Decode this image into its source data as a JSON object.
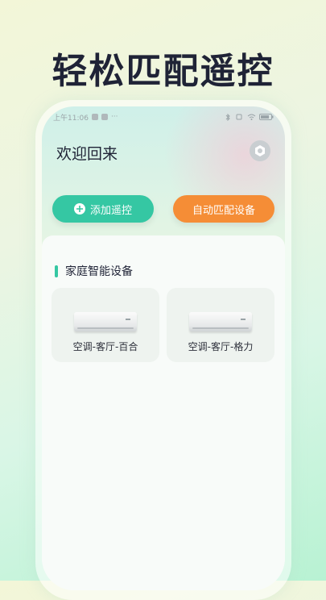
{
  "promo": {
    "headline": "轻松匹配遥控"
  },
  "status_bar": {
    "time": "上午11:06",
    "extra": "···"
  },
  "header": {
    "title": "欢迎回来",
    "settings_icon": "gear-icon"
  },
  "actions": {
    "add_remote": "添加遥控",
    "auto_match": "自动匹配设备"
  },
  "section": {
    "title": "家庭智能设备"
  },
  "devices": [
    {
      "name": "空调-客厅-百合",
      "icon": "air-conditioner-icon"
    },
    {
      "name": "空调-客厅-格力",
      "icon": "air-conditioner-icon"
    }
  ],
  "colors": {
    "accent_green": "#35c7a3",
    "accent_orange": "#f58d36",
    "text_dark": "#1f2336"
  }
}
